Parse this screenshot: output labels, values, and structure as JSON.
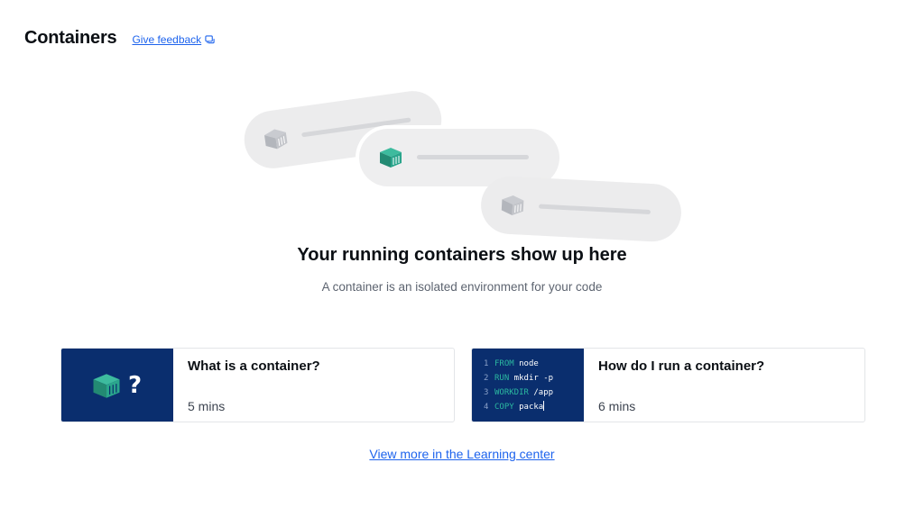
{
  "header": {
    "title": "Containers",
    "feedback_label": "Give feedback"
  },
  "empty_state": {
    "title": "Your running containers show up here",
    "subtitle": "A container is an isolated environment for your code"
  },
  "cards": [
    {
      "title": "What is a container?",
      "duration": "5 mins",
      "thumb_symbol": "?"
    },
    {
      "title": "How do I run a container?",
      "duration": "6 mins",
      "code_lines": [
        {
          "num": "1",
          "keyword": "FROM",
          "rest": " node"
        },
        {
          "num": "2",
          "keyword": "RUN",
          "rest": " mkdir -p"
        },
        {
          "num": "3",
          "keyword": "WORKDIR",
          "rest": " /app"
        },
        {
          "num": "4",
          "keyword": "COPY",
          "rest": " packa"
        }
      ]
    }
  ],
  "learning_center_link": "View more in the Learning center",
  "icons": {
    "container": "container-cube-icon",
    "feedback": "external-feedback-icon"
  },
  "colors": {
    "accent": "#1d63ed",
    "teal": "#2aa58c",
    "thumb_bg": "#0a2e6e",
    "grey_cube": "#b9bcc2"
  }
}
